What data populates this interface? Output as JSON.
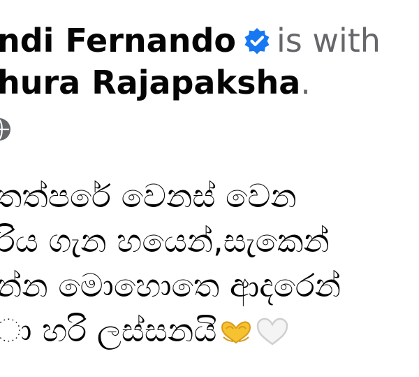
{
  "post": {
    "author": "ndi Fernando",
    "is_with": "is with",
    "tagged": "hura Rajapaksha",
    "period": ".",
    "lines": [
      "තත්පරේ වෙනස් වෙන",
      "රිය ගැන හයෙන්,සැකෙන්",
      "න්න මොහොතෙ ආදරෙන්",
      "ා හරි ලස්සනයි"
    ]
  },
  "icons": {
    "verified": "verified-badge-icon",
    "privacy": "globe-icon",
    "emoji1": "heart-hands-emoji-icon",
    "emoji2": "white-heart-emoji-icon"
  },
  "colors": {
    "verified_blue": "#1877f2",
    "muted": "#65676b",
    "text": "#050505",
    "heart_hands": "#f6c22f"
  }
}
